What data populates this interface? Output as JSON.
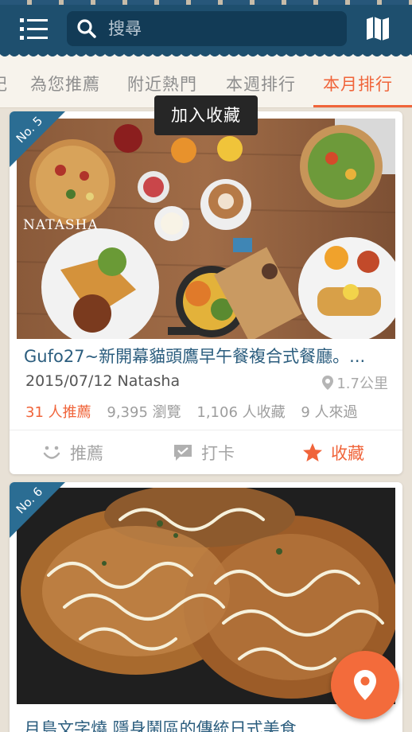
{
  "search": {
    "placeholder": "搜尋"
  },
  "tabs": [
    {
      "label": "記"
    },
    {
      "label": "為您推薦"
    },
    {
      "label": "附近熱門"
    },
    {
      "label": "本週排行"
    },
    {
      "label": "本月排行"
    }
  ],
  "tooltip": {
    "text": "加入收藏"
  },
  "cards": [
    {
      "rank": "No. 5",
      "photo_watermark": "NATASHA",
      "title": "Gufo27~新開幕貓頭鷹早午餐複合式餐廳。...",
      "meta": "2015/07/12 Natasha",
      "distance": "1.7公里",
      "stats": {
        "recommend": "31 人推薦",
        "views": "9,395 瀏覽",
        "favorites": "1,106 人收藏",
        "visited": "9 人來過"
      },
      "actions": {
        "recommend": "推薦",
        "checkin": "打卡",
        "favorite": "收藏"
      }
    },
    {
      "rank": "No. 6",
      "title": "月島文字燒 隱身鬧區的傳統日式美食"
    }
  ],
  "colors": {
    "header": "#1e4f6e",
    "accent": "#f0643a",
    "title": "#2b5d7e"
  }
}
